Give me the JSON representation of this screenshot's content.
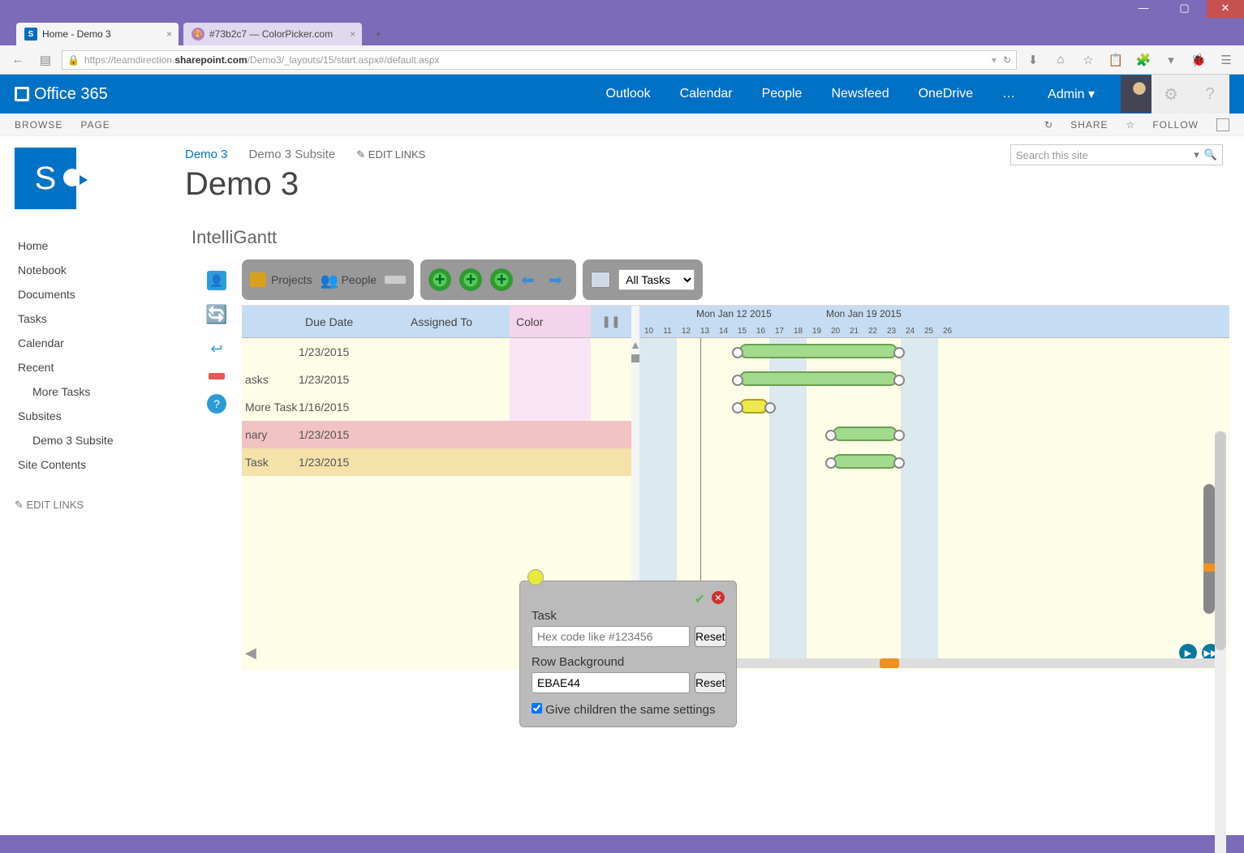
{
  "window": {
    "title": "Home - Demo 3"
  },
  "browserTabs": [
    {
      "label": "Home - Demo 3",
      "active": true,
      "favicon": "sharepoint"
    },
    {
      "label": "#73b2c7 — ColorPicker.com",
      "active": false,
      "favicon": "paint"
    }
  ],
  "url": {
    "prefix": "https://teamdirection.",
    "host": "sharepoint.com",
    "path": "/Demo3/_layouts/15/start.aspx#/default.aspx"
  },
  "o365": {
    "brand": "Office 365",
    "nav": [
      "Outlook",
      "Calendar",
      "People",
      "Newsfeed",
      "OneDrive"
    ],
    "more": "…",
    "user": "Admin ▾"
  },
  "ribbon": {
    "left": [
      "BROWSE",
      "PAGE"
    ],
    "right": [
      "SHARE",
      "FOLLOW"
    ]
  },
  "breadcrumb": {
    "active": "Demo 3",
    "siblings": [
      "Demo 3 Subsite"
    ],
    "edit": "EDIT LINKS"
  },
  "pageTitle": "Demo 3",
  "search": {
    "placeholder": "Search this site"
  },
  "quicklaunch": [
    {
      "label": "Home"
    },
    {
      "label": "Notebook"
    },
    {
      "label": "Documents"
    },
    {
      "label": "Tasks"
    },
    {
      "label": "Calendar"
    },
    {
      "label": "Recent"
    },
    {
      "label": "More Tasks",
      "sub": true
    },
    {
      "label": "Subsites"
    },
    {
      "label": "Demo 3 Subsite",
      "sub": true
    },
    {
      "label": "Site Contents"
    }
  ],
  "quicklaunchEdit": "EDIT LINKS",
  "appTitle": "IntelliGantt",
  "toolbar": {
    "projects": "Projects",
    "people": "People",
    "taskSelector": "All Tasks"
  },
  "gantt": {
    "columns": {
      "dueDate": "Due Date",
      "assignedTo": "Assigned To",
      "color": "Color",
      "pause": "❚❚"
    },
    "rows": [
      {
        "name": "",
        "due": "1/23/2015"
      },
      {
        "name": "asks",
        "due": "1/23/2015"
      },
      {
        "name": "More Task",
        "due": "1/16/2015"
      },
      {
        "name": "nary",
        "due": "1/23/2015",
        "selected": true
      },
      {
        "name": "Task",
        "due": "1/23/2015",
        "child": true
      }
    ],
    "timeline": {
      "weeks": [
        "Mon Jan 12 2015",
        "Mon Jan 19 2015"
      ],
      "days": [
        "10",
        "11",
        "12",
        "13",
        "14",
        "15",
        "16",
        "17",
        "18",
        "19",
        "20",
        "21",
        "22",
        "23",
        "24",
        "25",
        "26"
      ]
    }
  },
  "popup": {
    "taskLabel": "Task",
    "taskPlaceholder": "Hex code like #123456",
    "rowBgLabel": "Row Background",
    "rowBgValue": "EBAE44",
    "reset": "Reset",
    "childrenLabel": "Give children the same settings"
  }
}
